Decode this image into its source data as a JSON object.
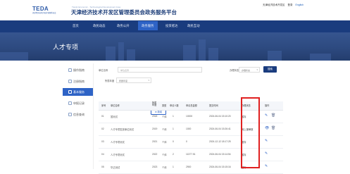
{
  "logo": {
    "brand": "TEDA",
    "sub": "天津经济技术开发区管理委员会"
  },
  "site": {
    "title": "天津经济技术开发区管理委员会政务服务平台",
    "title_en": "Tianjin Economic - Technological Development Area"
  },
  "top_links": {
    "home": "天津经济技术开发区",
    "login": "登录",
    "lang": "English"
  },
  "nav": {
    "items": [
      "首页",
      "政民动态",
      "政务公开",
      "政务服务",
      "投资者达",
      "政民互动"
    ],
    "active": "政务服务"
  },
  "banner": {
    "title": "人才专项"
  },
  "sidebar": {
    "items": [
      {
        "label": "操作指南",
        "icon": "document-icon"
      },
      {
        "label": "注册指南",
        "icon": "register-icon"
      },
      {
        "label": "基本服务",
        "icon": "grid-icon"
      },
      {
        "label": "申报记录",
        "icon": "record-icon"
      },
      {
        "label": "信息查询",
        "icon": "search-icon"
      }
    ],
    "active_index": 2
  },
  "filters": {
    "company_label": "单位名称",
    "company_placeholder": "单位名称",
    "status_label": "办理状态",
    "status_value": "办理状态",
    "category_label": "所属年度",
    "category_value": "所属年度",
    "search_label": "搜索",
    "add_label": "新增"
  },
  "table": {
    "columns": [
      "序号",
      "单位名称",
      "所属年度",
      "类型",
      "申请人数",
      "申请总金额",
      "提交时间",
      "办理状态",
      "操作"
    ],
    "rows": [
      {
        "no": "01",
        "name": "暂测试",
        "year": "2018",
        "type": "个体",
        "people": "1",
        "amount": "10000",
        "time": "2024-06-04 15:10:20",
        "status": "暂存",
        "ops": [
          "edit",
          "delete"
        ]
      },
      {
        "no": "02",
        "name": "人才专项发放单位测试",
        "year": "2019",
        "type": "个体",
        "people": "1",
        "amount": "1000",
        "time": "2024-06-04 15:26:41",
        "status": "网上报审核",
        "ops": [
          "view",
          "delete"
        ]
      },
      {
        "no": "03",
        "name": "人才专项测试",
        "year": "2021",
        "type": "个体",
        "people": "0",
        "amount": "0",
        "time": "2024-12-12 18:17:25",
        "status": "暂存",
        "ops": [
          "edit"
        ]
      },
      {
        "no": "04",
        "name": "人才专项测试",
        "year": "2022",
        "type": "个体",
        "people": "2",
        "amount": "11377.51",
        "time": "2024-06-04 15:14:54",
        "status": "暂存",
        "ops": [
          "edit"
        ]
      },
      {
        "no": "05",
        "name": "华达测试",
        "year": "2023",
        "type": "个体",
        "people": "1",
        "amount": "2900",
        "time": "2024-06-04 15:15:16",
        "status": "暂存",
        "ops": [
          "edit"
        ]
      }
    ]
  },
  "colors": {
    "nav": "#1a3c7e",
    "accent": "#2e63c6",
    "highlight": "#e02020"
  }
}
